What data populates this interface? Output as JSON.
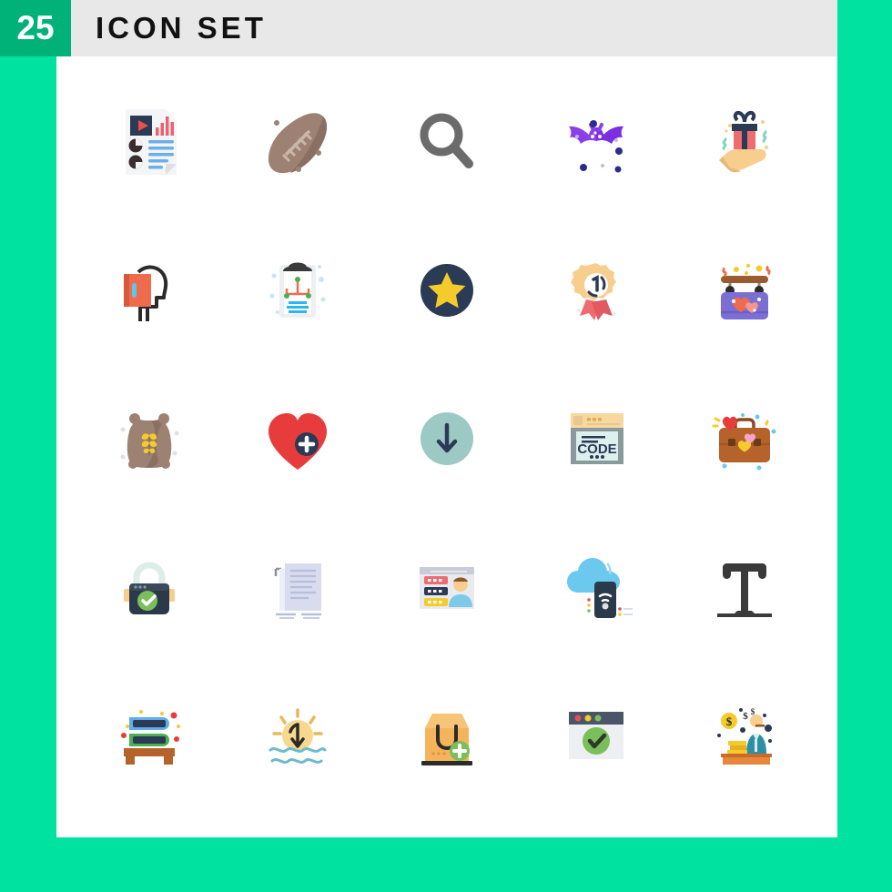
{
  "header": {
    "count": "25",
    "title": "ICON SET",
    "badge_color": "#00B277",
    "bar_color": "#E8E8E8",
    "title_color": "#111111"
  },
  "page": {
    "background_color": "#00E2A0",
    "canvas_color": "#FFFFFF",
    "columns": 5,
    "rows": 5,
    "total_icons": 25
  },
  "icons": [
    {
      "name": "report-document-icon",
      "label": "Report Document",
      "row": 1,
      "col": 1,
      "colors": [
        "#F4F5F7",
        "#2B3A55",
        "#EC4E4E",
        "#E8636F",
        "#6BAEE8"
      ]
    },
    {
      "name": "american-football-icon",
      "label": "American Football",
      "row": 1,
      "col": 2,
      "colors": [
        "#9D8273",
        "#8A7062",
        "#C9B6A8"
      ]
    },
    {
      "name": "search-icon",
      "label": "Search",
      "row": 1,
      "col": 3,
      "colors": [
        "#6B6B6B"
      ]
    },
    {
      "name": "bat-icon",
      "label": "Bat",
      "row": 1,
      "col": 4,
      "colors": [
        "#8A3FE8",
        "#7B2FE0",
        "#2B2B8F"
      ]
    },
    {
      "name": "gift-in-hand-icon",
      "label": "Gift In Hand",
      "row": 1,
      "col": 5,
      "colors": [
        "#F7CE8E",
        "#2B3A55",
        "#EE6C70",
        "#7FD4C4"
      ]
    },
    {
      "name": "knowledge-head-icon",
      "label": "Knowledge",
      "row": 2,
      "col": 1,
      "colors": [
        "#2B2B2B",
        "#EE6C4D",
        "#5BC8E8"
      ]
    },
    {
      "name": "clipboard-chart-icon",
      "label": "Clipboard Chart",
      "row": 2,
      "col": 2,
      "colors": [
        "#EDEFF2",
        "#3A3A3A",
        "#EE6C4D",
        "#4CAF50",
        "#29B6F6"
      ]
    },
    {
      "name": "star-badge-icon",
      "label": "Star Badge",
      "row": 2,
      "col": 3,
      "colors": [
        "#2B3A55",
        "#F5CB2B"
      ]
    },
    {
      "name": "first-place-medal-icon",
      "label": "First Place Medal",
      "row": 2,
      "col": 4,
      "colors": [
        "#F7CE8E",
        "#FFFFFF",
        "#2B3A55",
        "#EE6C70"
      ]
    },
    {
      "name": "hanging-heart-sign-icon",
      "label": "Hanging Heart Sign",
      "row": 2,
      "col": 5,
      "colors": [
        "#7B6FD4",
        "#9B5B2E",
        "#EE6C4D",
        "#F5CB2B"
      ]
    },
    {
      "name": "grain-sack-icon",
      "label": "Grain Sack",
      "row": 3,
      "col": 1,
      "colors": [
        "#9D8273",
        "#8A7062",
        "#F5CB2B"
      ]
    },
    {
      "name": "add-heart-icon",
      "label": "Add To Favourites",
      "row": 3,
      "col": 2,
      "colors": [
        "#E83C3C",
        "#2B3A55",
        "#FFFFFF"
      ]
    },
    {
      "name": "download-arrow-icon",
      "label": "Download",
      "row": 3,
      "col": 3,
      "colors": [
        "#9DC9C4",
        "#2B3A55"
      ]
    },
    {
      "name": "code-window-icon",
      "label": "Code Window",
      "row": 3,
      "col": 4,
      "colors": [
        "#F7D9A0",
        "#DDF0EE",
        "#8A9A9A",
        "#2B3A55"
      ]
    },
    {
      "name": "briefcase-love-icon",
      "label": "Love Briefcase",
      "row": 3,
      "col": 5,
      "colors": [
        "#B5622B",
        "#A3561F",
        "#E83C3C",
        "#F5A5C8",
        "#F5CB2B"
      ]
    },
    {
      "name": "secure-lock-icon",
      "label": "Secure Lock",
      "row": 4,
      "col": 1,
      "colors": [
        "#2B3A4A",
        "#DDEEE8",
        "#7BBF5B",
        "#F7CE8E"
      ]
    },
    {
      "name": "copy-documents-icon",
      "label": "Copy Documents",
      "row": 4,
      "col": 2,
      "colors": [
        "#D8DCEE",
        "#EDEFF8",
        "#B8BEDC"
      ]
    },
    {
      "name": "user-profile-page-icon",
      "label": "User Profile Page",
      "row": 4,
      "col": 3,
      "colors": [
        "#E8EAF0",
        "#C8CBD8",
        "#EE6C70",
        "#2B3A55",
        "#F5CB2B",
        "#7FC9E8"
      ]
    },
    {
      "name": "cloud-mobile-wifi-icon",
      "label": "Cloud Mobile Wifi",
      "row": 4,
      "col": 4,
      "colors": [
        "#6BC9EE",
        "#2B3A4A",
        "#FFFFFF"
      ]
    },
    {
      "name": "text-tool-icon",
      "label": "Text Tool",
      "row": 4,
      "col": 5,
      "colors": [
        "#3A3A3A"
      ]
    },
    {
      "name": "book-stack-icon",
      "label": "Book Stack",
      "row": 5,
      "col": 1,
      "colors": [
        "#4CAF50",
        "#5BAEE8",
        "#2B3A55",
        "#B5622B",
        "#E83C3C",
        "#F5CB2B"
      ]
    },
    {
      "name": "sunset-icon",
      "label": "Sunset",
      "row": 5,
      "col": 2,
      "colors": [
        "#F7D98E",
        "#E8B85B",
        "#6BBCCC",
        "#2B2B2B"
      ]
    },
    {
      "name": "add-shopping-bag-icon",
      "label": "Add Shopping Bag",
      "row": 5,
      "col": 3,
      "colors": [
        "#F5B45B",
        "#2B2B2B",
        "#7BBF5B",
        "#FFFFFF"
      ]
    },
    {
      "name": "approved-window-icon",
      "label": "Approved Window",
      "row": 5,
      "col": 4,
      "colors": [
        "#4A5568",
        "#EDEFF2",
        "#7BBF5B",
        "#E05252",
        "#F5CB2B"
      ]
    },
    {
      "name": "banker-desk-icon",
      "label": "Banker At Desk",
      "row": 5,
      "col": 5,
      "colors": [
        "#C96A2B",
        "#E8873C",
        "#F5CB2B",
        "#2B8FA8",
        "#F7CE8E",
        "#2B3A55"
      ]
    }
  ]
}
